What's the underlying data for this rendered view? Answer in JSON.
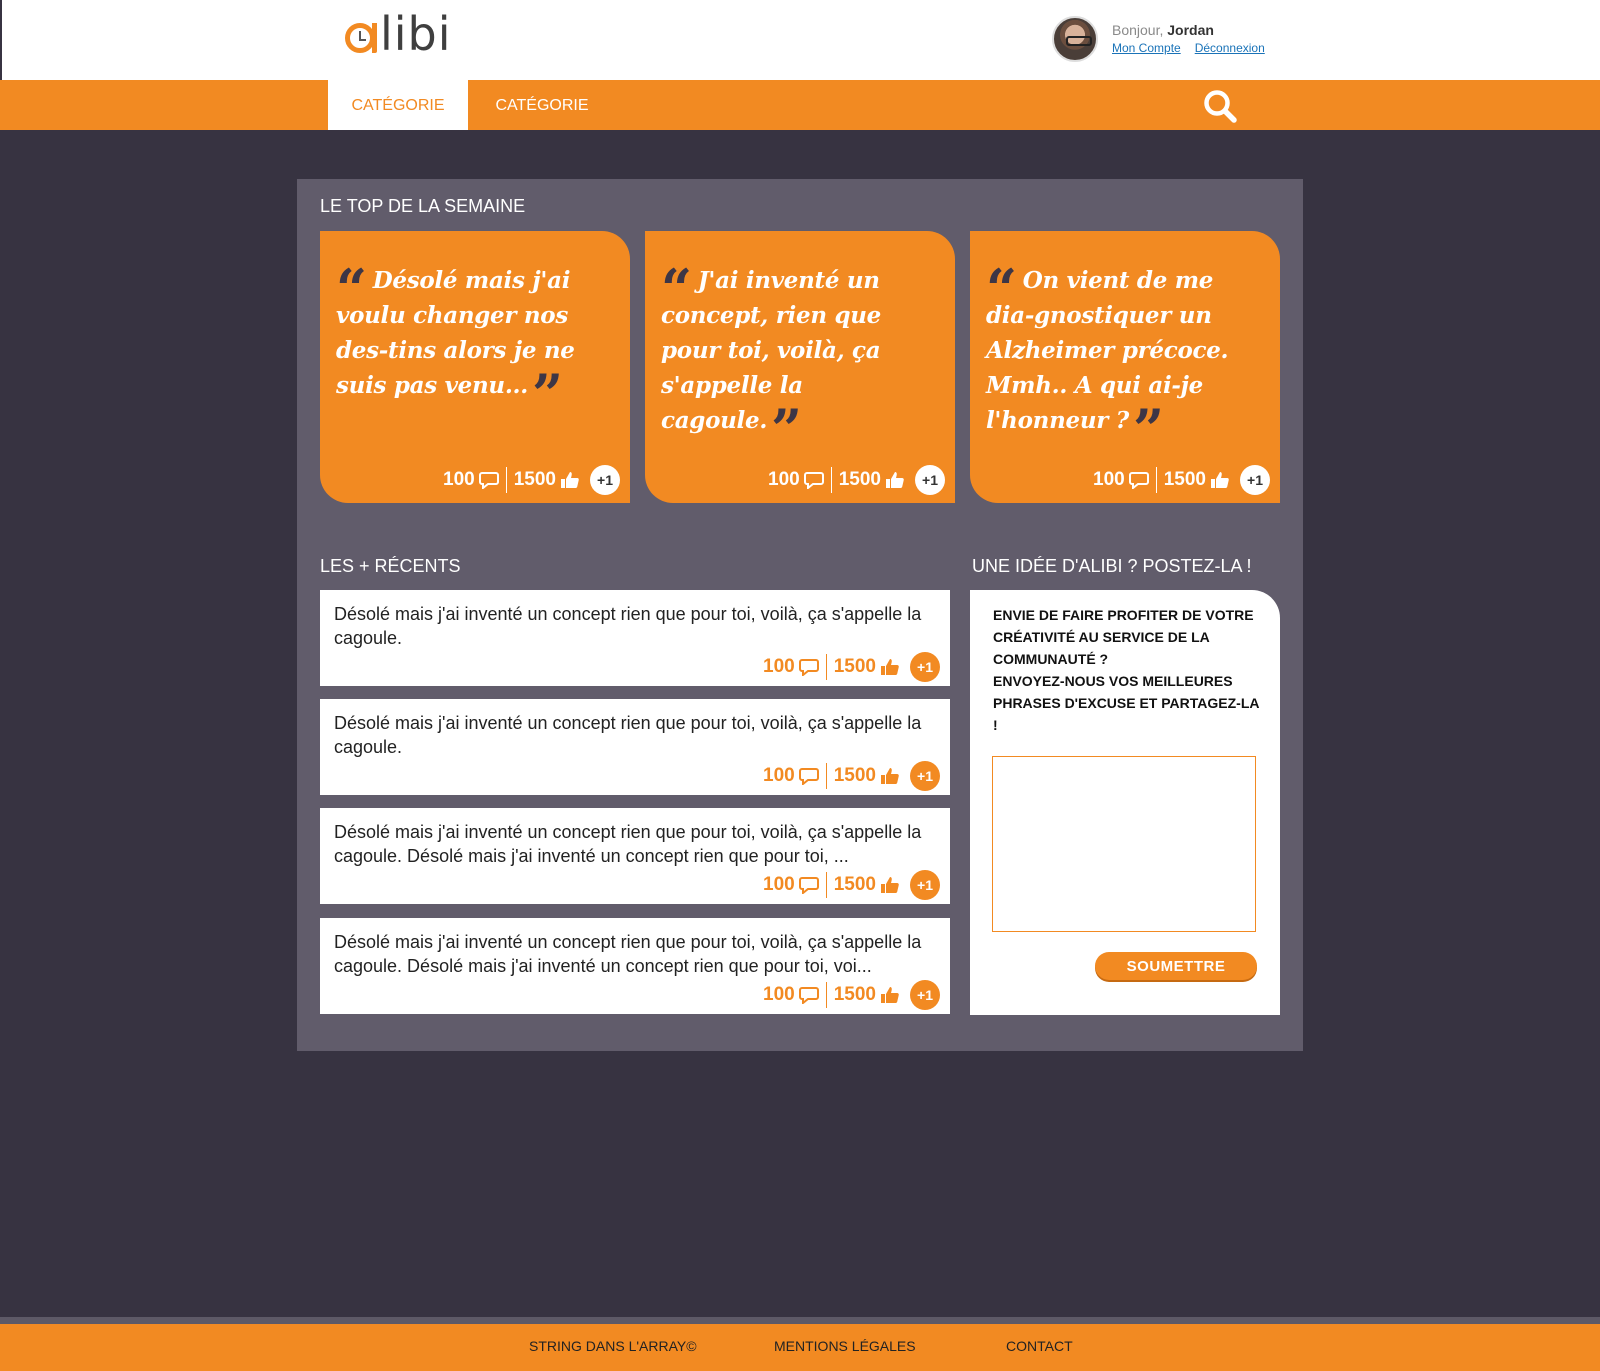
{
  "brand": {
    "logo_text": "libi",
    "accent_color": "#f28a22",
    "dark_color": "#373341"
  },
  "user": {
    "greeting": "Bonjour,",
    "name": "Jordan",
    "account_link": "Mon Compte",
    "logout_link": "Déconnexion"
  },
  "nav": {
    "tabs": [
      {
        "label": "CATÉGORIE",
        "active": true
      },
      {
        "label": "CATÉGORIE",
        "active": false
      }
    ],
    "search_icon": "search-icon"
  },
  "top_section": {
    "title": "LE TOP DE LA SEMAINE",
    "cards": [
      {
        "quote": "Désolé mais j'ai voulu changer nos des-tins alors je ne suis pas venu...",
        "comments": "100",
        "likes": "1500",
        "plus": "+1"
      },
      {
        "quote": "J'ai inventé un concept, rien que pour toi, voilà, ça s'appelle la cagoule.",
        "comments": "100",
        "likes": "1500",
        "plus": "+1"
      },
      {
        "quote": "On vient de me dia-gnostiquer un Alzheimer précoce. Mmh.. A qui ai-je l'honneur ?",
        "comments": "100",
        "likes": "1500",
        "plus": "+1"
      }
    ]
  },
  "recent_section": {
    "title": "LES + RÉCENTS",
    "items": [
      {
        "text": "Désolé mais j'ai inventé un concept rien que pour toi, voilà, ça s'appelle la cagoule.",
        "comments": "100",
        "likes": "1500",
        "plus": "+1"
      },
      {
        "text": "Désolé mais j'ai inventé un concept rien que pour toi, voilà, ça s'appelle la cagoule.",
        "comments": "100",
        "likes": "1500",
        "plus": "+1"
      },
      {
        "text": "Désolé mais j'ai inventé un concept rien que pour toi, voilà, ça s'appelle la cagoule. Désolé mais j'ai inventé un concept rien que pour toi, ...",
        "comments": "100",
        "likes": "1500",
        "plus": "+1"
      },
      {
        "text": "Désolé mais j'ai inventé un concept rien que pour toi, voilà, ça s'appelle la cagoule. Désolé mais j'ai inventé un concept rien que pour toi, voi...",
        "comments": "100",
        "likes": "1500",
        "plus": "+1"
      }
    ]
  },
  "submit_section": {
    "title": "UNE IDÉE D'ALIBI ? POSTEZ-LA !",
    "intro_line1": "Envie de faire profiter de votre créativité au service de la communauté ?",
    "intro_line2": "Envoyez-nous vos meilleures phrases d'excuse et partagez-la !",
    "textarea_value": "",
    "button_label": "SOUMETTRE"
  },
  "footer": {
    "links": [
      "STRING DANS L'ARRAY©",
      "MENTIONS LÉGALES",
      "CONTACT"
    ]
  }
}
